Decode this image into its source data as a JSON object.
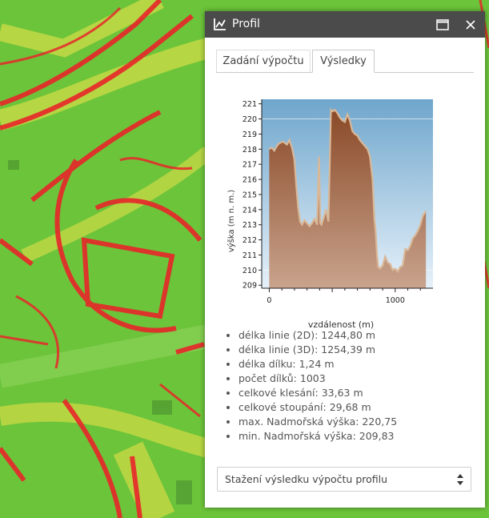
{
  "panel": {
    "title": "Profil",
    "icons": {
      "title": "profile-chart-icon",
      "maximize": "maximize-icon",
      "close": "close-icon"
    }
  },
  "tabs": [
    {
      "label": "Zadání výpočtu",
      "active": false
    },
    {
      "label": "Výsledky",
      "active": true
    }
  ],
  "chart_data": {
    "type": "area",
    "xlabel": "vzdálenost (m)",
    "ylabel": "výška (m n. m.)",
    "xlim": [
      -60,
      1300
    ],
    "ylim": [
      208.8,
      221.3
    ],
    "xticks": [
      0,
      1000
    ],
    "yticks": [
      209,
      210,
      211,
      212,
      213,
      214,
      215,
      216,
      217,
      218,
      219,
      220,
      221
    ],
    "x": [
      0,
      20,
      40,
      60,
      80,
      110,
      140,
      160,
      180,
      200,
      215,
      230,
      245,
      260,
      280,
      300,
      320,
      340,
      360,
      380,
      395,
      405,
      415,
      430,
      450,
      470,
      490,
      505,
      520,
      540,
      560,
      580,
      600,
      620,
      640,
      660,
      680,
      700,
      720,
      740,
      760,
      780,
      800,
      820,
      835,
      845,
      855,
      865,
      880,
      900,
      920,
      940,
      960,
      980,
      1000,
      1020,
      1040,
      1060,
      1080,
      1100,
      1120,
      1140,
      1160,
      1180,
      1200,
      1220,
      1244
    ],
    "values": [
      218.0,
      218.1,
      217.9,
      218.2,
      218.4,
      218.5,
      218.3,
      218.6,
      218.1,
      217.3,
      215.5,
      214.1,
      213.2,
      213.0,
      213.3,
      213.1,
      212.9,
      213.1,
      213.4,
      213.0,
      217.5,
      213.1,
      213.0,
      213.4,
      214.0,
      213.2,
      220.6,
      220.5,
      220.6,
      220.4,
      220.1,
      219.9,
      219.8,
      220.3,
      219.9,
      219.2,
      219.0,
      218.9,
      218.6,
      218.4,
      218.2,
      218.0,
      217.5,
      216.0,
      213.4,
      212.5,
      211.0,
      210.2,
      210.1,
      210.3,
      210.9,
      210.5,
      210.4,
      210.0,
      210.1,
      209.9,
      210.2,
      210.3,
      211.4,
      211.3,
      211.6,
      212.1,
      212.3,
      212.6,
      213.0,
      213.6,
      213.9
    ],
    "grid": false,
    "colors": {
      "sky_top": "#6fa6cc",
      "sky_bottom": "#e6f1fa",
      "fill_top": "#8a4a28",
      "fill_bottom": "#c9a38d",
      "outline": "#d9b898"
    }
  },
  "results": [
    "délka linie (2D): 1244,80 m",
    "délka linie (3D): 1254,39 m",
    "délka dílku: 1,24 m",
    "počet dílků: 1003",
    "celkové klesání: 33,63 m",
    "celkové stoupání: 29,68 m",
    "max. Nadmořská výška: 220,75",
    "min. Nadmořská výška: 209,83"
  ],
  "download": {
    "selected": "Stažení výsledku výpočtu profilu",
    "icon": "select-arrows-icon"
  }
}
